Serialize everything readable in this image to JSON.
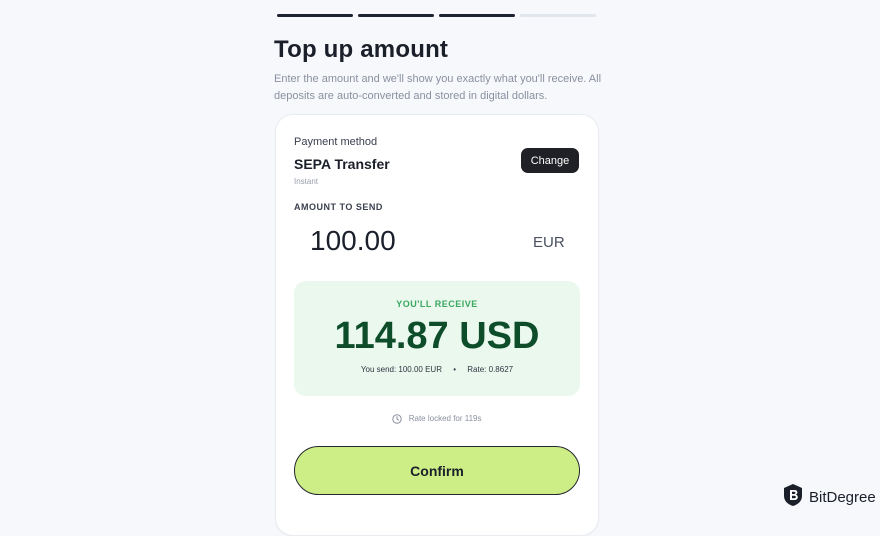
{
  "progress": {
    "steps_total": 4,
    "steps_completed": 3
  },
  "header": {
    "title": "Top up amount",
    "subtitle": "Enter the amount and we'll show you exactly what you'll receive. All deposits are auto-converted and stored in digital dollars."
  },
  "payment": {
    "label": "Payment method",
    "method": "SEPA Transfer",
    "speed": "Instant",
    "change_label": "Change"
  },
  "amount": {
    "label": "AMOUNT TO SEND",
    "value": "100.00",
    "currency": "EUR"
  },
  "receive": {
    "label": "YOU'LL RECEIVE",
    "amount": "114.87 USD",
    "send_text": "You send: 100.00 EUR",
    "separator": "•",
    "rate_text": "Rate: 0.8627"
  },
  "rate_lock": {
    "text": "Rate locked for 119s"
  },
  "actions": {
    "confirm_label": "Confirm"
  },
  "watermark": {
    "text": "BitDegree"
  },
  "colors": {
    "confirm_bg": "#cdee86",
    "receive_bg": "#eaf8ee",
    "receive_amount": "#0e4d2a",
    "receive_label": "#3aa860"
  }
}
